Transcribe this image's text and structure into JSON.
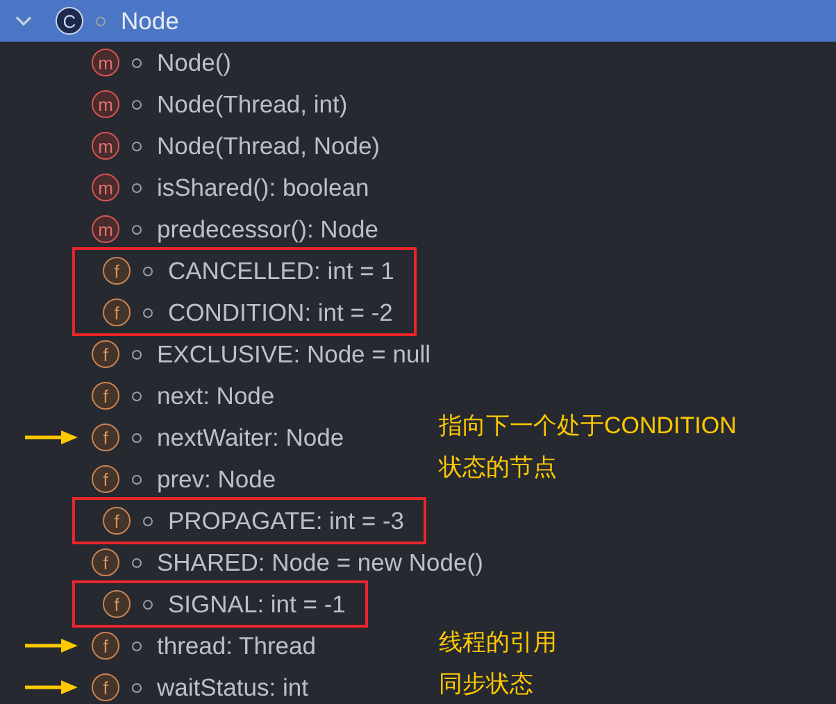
{
  "header": {
    "label": "Node",
    "icon_letter": "C",
    "expanded": true,
    "selected": true
  },
  "members": [
    {
      "kind": "method",
      "icon_letter": "m",
      "label": "Node()",
      "boxed": false,
      "arrow": false
    },
    {
      "kind": "method",
      "icon_letter": "m",
      "label": "Node(Thread, int)",
      "boxed": false,
      "arrow": false
    },
    {
      "kind": "method",
      "icon_letter": "m",
      "label": "Node(Thread, Node)",
      "boxed": false,
      "arrow": false
    },
    {
      "kind": "method",
      "icon_letter": "m",
      "label": "isShared(): boolean",
      "boxed": false,
      "arrow": false
    },
    {
      "kind": "method",
      "icon_letter": "m",
      "label": "predecessor(): Node",
      "boxed": false,
      "arrow": false
    },
    {
      "kind": "field",
      "icon_letter": "f",
      "label": "CANCELLED: int = 1",
      "boxed": true,
      "arrow": false
    },
    {
      "kind": "field",
      "icon_letter": "f",
      "label": "CONDITION: int = -2",
      "boxed": true,
      "arrow": false
    },
    {
      "kind": "field",
      "icon_letter": "f",
      "label": "EXCLUSIVE: Node = null",
      "boxed": false,
      "arrow": false
    },
    {
      "kind": "field",
      "icon_letter": "f",
      "label": "next: Node",
      "boxed": false,
      "arrow": false
    },
    {
      "kind": "field",
      "icon_letter": "f",
      "label": "nextWaiter: Node",
      "boxed": false,
      "arrow": true,
      "note": [
        "指向下一个处于CONDITION",
        "状态的节点"
      ]
    },
    {
      "kind": "field",
      "icon_letter": "f",
      "label": "prev: Node",
      "boxed": false,
      "arrow": false
    },
    {
      "kind": "field",
      "icon_letter": "f",
      "label": "PROPAGATE: int = -3",
      "boxed": true,
      "arrow": false
    },
    {
      "kind": "field",
      "icon_letter": "f",
      "label": "SHARED: Node = new Node()",
      "boxed": false,
      "arrow": false
    },
    {
      "kind": "field",
      "icon_letter": "f",
      "label": "SIGNAL: int = -1",
      "boxed": true,
      "arrow": false
    },
    {
      "kind": "field",
      "icon_letter": "f",
      "label": "thread: Thread",
      "boxed": false,
      "arrow": true,
      "note": [
        "线程的引用"
      ]
    },
    {
      "kind": "field",
      "icon_letter": "f",
      "label": "waitStatus: int",
      "boxed": false,
      "arrow": true,
      "note": [
        "同步状态"
      ]
    }
  ]
}
